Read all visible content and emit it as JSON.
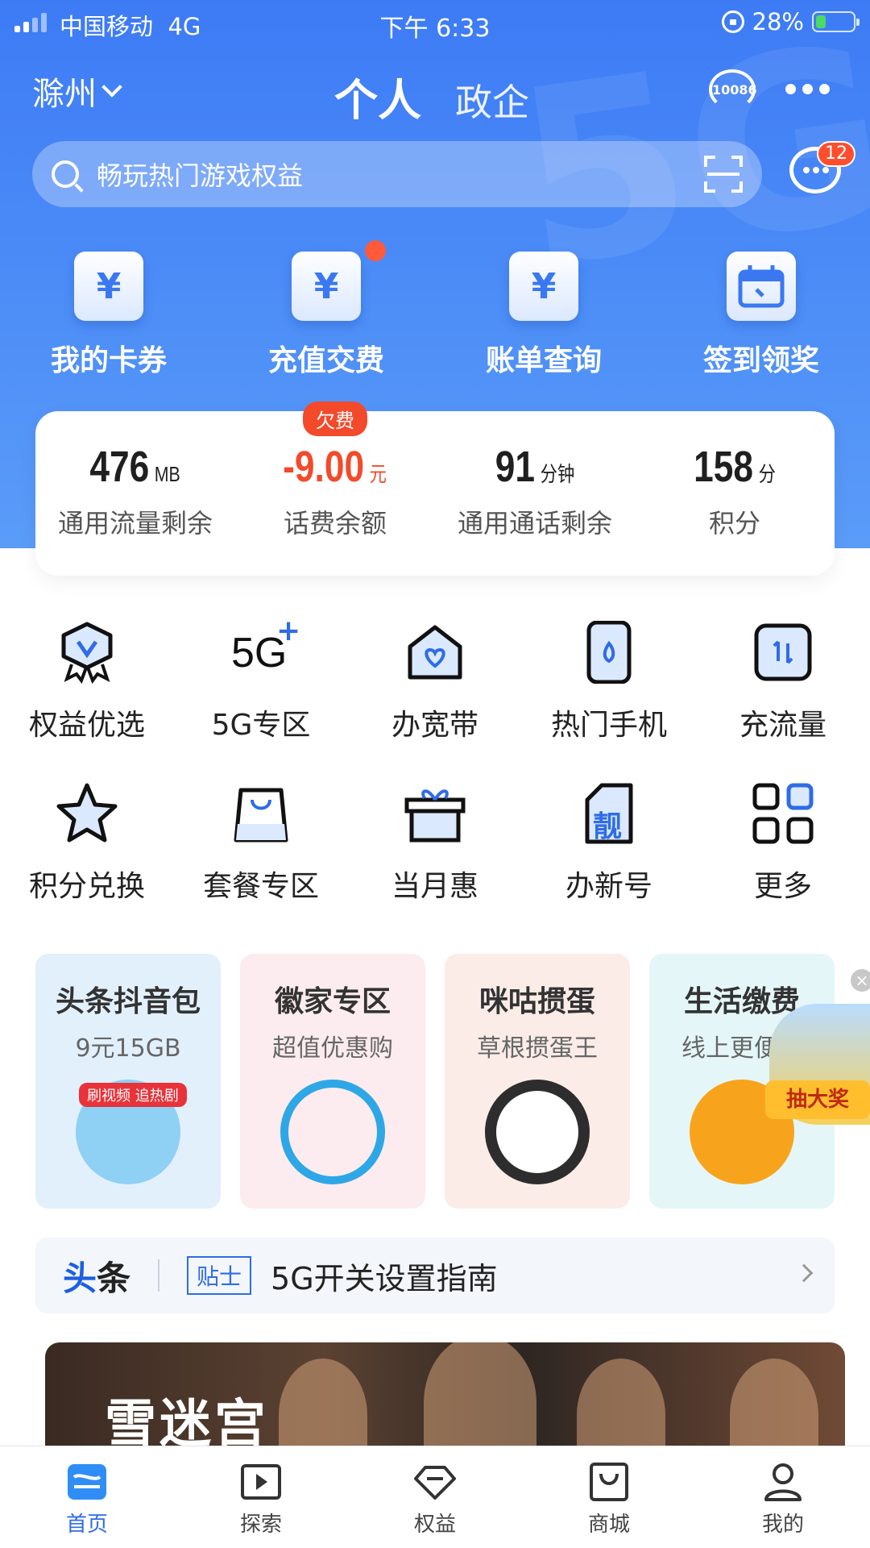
{
  "status_bar": {
    "carrier": "中国移动",
    "network": "4G",
    "time": "下午 6:33",
    "battery": "28%",
    "battery_level": 0.28
  },
  "header": {
    "city": "滁州",
    "tabs": [
      {
        "label": "个人",
        "active": true
      },
      {
        "label": "政企",
        "active": false
      }
    ],
    "hotline": "10086",
    "search_placeholder": "畅玩热门游戏权益",
    "message_badge": "12",
    "watermark": "5G"
  },
  "quick_actions": [
    {
      "label": "我的卡券",
      "icon": "coupon-icon",
      "glyph": "¥"
    },
    {
      "label": "充值交费",
      "icon": "recharge-icon",
      "glyph": "¥",
      "dot": true
    },
    {
      "label": "账单查询",
      "icon": "bill-icon",
      "glyph": "¥"
    },
    {
      "label": "签到领奖",
      "icon": "calendar-icon",
      "glyph": ""
    }
  ],
  "balance": {
    "data": {
      "value": "476",
      "unit": "MB",
      "label": "通用流量剩余"
    },
    "fee": {
      "value": "-9.00",
      "unit": "元",
      "label": "话费余额",
      "tag": "欠费"
    },
    "calls": {
      "value": "91",
      "unit": "分钟",
      "label": "通用通话剩余"
    },
    "points": {
      "value": "158",
      "unit": "分",
      "label": "积分"
    }
  },
  "services": [
    [
      {
        "label": "权益优选",
        "icon": "badge-v-icon"
      },
      {
        "label": "5G专区",
        "icon": "5g-plus-icon",
        "glyph": "5G"
      },
      {
        "label": "办宽带",
        "icon": "house-heart-icon"
      },
      {
        "label": "热门手机",
        "icon": "phone-icon"
      },
      {
        "label": "充流量",
        "icon": "data-transfer-icon"
      }
    ],
    [
      {
        "label": "积分兑换",
        "icon": "star-icon"
      },
      {
        "label": "套餐专区",
        "icon": "bag-icon"
      },
      {
        "label": "当月惠",
        "icon": "gift-box-icon"
      },
      {
        "label": "办新号",
        "icon": "sim-card-icon",
        "glyph": "靓"
      },
      {
        "label": "更多",
        "icon": "grid-more-icon"
      }
    ]
  ],
  "promos": [
    {
      "title": "头条抖音包",
      "subtitle": "9元15GB",
      "art_text": "刷视频 追热剧",
      "bg": "#e2f0fc",
      "art": "#8fd0f5"
    },
    {
      "title": "徽家专区",
      "subtitle": "超值优惠购",
      "bg": "#fdecef",
      "art": "#f6b54a"
    },
    {
      "title": "咪咕掼蛋",
      "subtitle": "草根掼蛋王",
      "bg": "#fbece8",
      "art": "#2d2d2d"
    },
    {
      "title": "生活缴费",
      "subtitle": "线上更便捷",
      "bg": "#e4f6f8",
      "art": "#f7a41c"
    }
  ],
  "float_ad": {
    "label": "抽大奖",
    "close": "×"
  },
  "news": {
    "logo_a": "头",
    "logo_b": "条",
    "tag": "贴士",
    "text": "5G开关设置指南",
    "arrow": "›"
  },
  "banner": {
    "title": "雪迷宫"
  },
  "tabbar": [
    {
      "label": "首页",
      "icon": "home-icon",
      "active": true
    },
    {
      "label": "探索",
      "icon": "play-icon",
      "active": false
    },
    {
      "label": "权益",
      "icon": "diamond-icon",
      "active": false
    },
    {
      "label": "商城",
      "icon": "shop-bag-icon",
      "active": false
    },
    {
      "label": "我的",
      "icon": "user-icon",
      "active": false
    }
  ],
  "colors": {
    "brand_blue": "#3d7bf5",
    "alert_red": "#f24a2b",
    "tab_active": "#2f6ce6"
  }
}
